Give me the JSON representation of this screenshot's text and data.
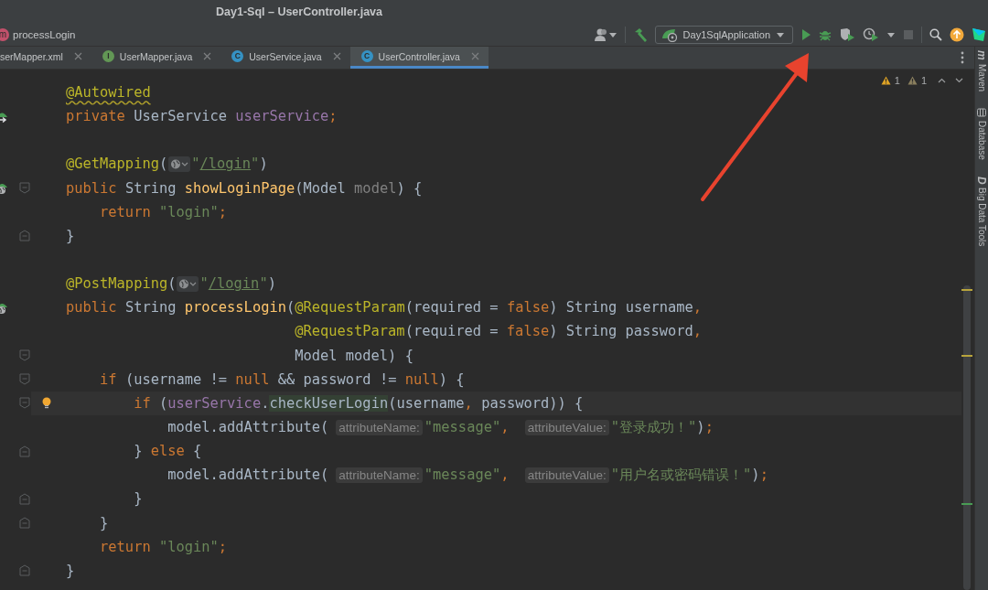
{
  "window": {
    "title": "Day1-Sql – UserController.java"
  },
  "breadcrumb": {
    "icon_text": "m",
    "label": "processLogin"
  },
  "toolbar": {
    "run_configuration": "Day1SqlApplication"
  },
  "tabs": [
    {
      "label": "serMapper.xml",
      "selected": false
    },
    {
      "label": "UserMapper.java",
      "kind": "interface",
      "icon_text": "I",
      "selected": false
    },
    {
      "label": "UserService.java",
      "kind": "class",
      "icon_text": "C",
      "selected": false
    },
    {
      "label": "UserController.java",
      "kind": "class",
      "icon_text": "C",
      "selected": true
    }
  ],
  "inspections": [
    {
      "kind": "warning",
      "count": "1"
    },
    {
      "kind": "weak",
      "count": "1"
    }
  ],
  "tool_windows": [
    {
      "label": "Maven",
      "kind": "letter",
      "icon_text": "m"
    },
    {
      "label": "Database",
      "kind": "database"
    },
    {
      "label": "Big Data Tools",
      "kind": "letter",
      "icon_text": "D"
    }
  ],
  "lines": [
    {
      "segments": [
        {
          "kind": "code",
          "tokens": [
            {
              "kind": "annotation-warn",
              "text": "@Autowired"
            }
          ]
        }
      ]
    },
    {
      "gutter_icon": {
        "kind": "bean"
      },
      "segments": [
        {
          "kind": "code",
          "tokens": [
            {
              "kind": "keyword",
              "text": "private "
            },
            {
              "kind": "plain",
              "text": "UserService "
            },
            {
              "kind": "field",
              "text": "userService"
            },
            {
              "kind": "keyword",
              "text": ";"
            }
          ]
        }
      ]
    },
    {
      "blank_line_before": true,
      "segments": [
        {
          "kind": "code",
          "tokens": [
            {
              "kind": "annotation",
              "text": "@GetMapping"
            },
            {
              "kind": "plain",
              "text": "("
            }
          ]
        },
        {
          "kind": "globe"
        },
        {
          "kind": "code",
          "tokens": [
            {
              "kind": "string",
              "text": "\""
            },
            {
              "kind": "link",
              "text": "/login"
            },
            {
              "kind": "string",
              "text": "\""
            },
            {
              "kind": "plain",
              "text": ")"
            }
          ]
        }
      ]
    },
    {
      "gutter_icon": {
        "kind": "endpoint"
      },
      "fold_marker": {
        "kind": "start"
      },
      "segments": [
        {
          "kind": "code",
          "tokens": [
            {
              "kind": "keyword",
              "text": "public "
            },
            {
              "kind": "plain",
              "text": "String "
            },
            {
              "kind": "method",
              "text": "showLoginPage"
            },
            {
              "kind": "plain",
              "text": "(Model "
            },
            {
              "kind": "unused",
              "text": "model"
            },
            {
              "kind": "plain",
              "text": ") {"
            }
          ]
        }
      ]
    },
    {
      "segments": [
        {
          "kind": "code",
          "tokens": [
            {
              "kind": "keyword",
              "text": "    return "
            },
            {
              "kind": "string",
              "text": "\"login\""
            },
            {
              "kind": "keyword",
              "text": ";"
            }
          ]
        }
      ]
    },
    {
      "fold_marker": {
        "kind": "end"
      },
      "segments": [
        {
          "kind": "code",
          "tokens": [
            {
              "kind": "plain",
              "text": "}"
            }
          ]
        }
      ]
    },
    {
      "blank_line_before": true,
      "segments": [
        {
          "kind": "code",
          "tokens": [
            {
              "kind": "annotation",
              "text": "@PostMapping"
            },
            {
              "kind": "plain",
              "text": "("
            }
          ]
        },
        {
          "kind": "globe"
        },
        {
          "kind": "code",
          "tokens": [
            {
              "kind": "string",
              "text": "\""
            },
            {
              "kind": "link",
              "text": "/login"
            },
            {
              "kind": "string",
              "text": "\""
            },
            {
              "kind": "plain",
              "text": ")"
            }
          ]
        }
      ]
    },
    {
      "gutter_icon": {
        "kind": "endpoint"
      },
      "segments": [
        {
          "kind": "code",
          "tokens": [
            {
              "kind": "keyword",
              "text": "public "
            },
            {
              "kind": "plain",
              "text": "String "
            },
            {
              "kind": "method",
              "text": "processLogin"
            },
            {
              "kind": "plain",
              "text": "("
            },
            {
              "kind": "annotation",
              "text": "@RequestParam"
            },
            {
              "kind": "plain",
              "text": "(required = "
            },
            {
              "kind": "keyword",
              "text": "false"
            },
            {
              "kind": "plain",
              "text": ") String username"
            },
            {
              "kind": "keyword",
              "text": ","
            }
          ]
        }
      ]
    },
    {
      "segments": [
        {
          "kind": "code",
          "tokens": [
            {
              "kind": "annotation",
              "text": "                           @RequestParam"
            },
            {
              "kind": "plain",
              "text": "(required = "
            },
            {
              "kind": "keyword",
              "text": "false"
            },
            {
              "kind": "plain",
              "text": ") String password"
            },
            {
              "kind": "keyword",
              "text": ","
            }
          ]
        }
      ]
    },
    {
      "fold_marker": {
        "kind": "start"
      },
      "segments": [
        {
          "kind": "code",
          "tokens": [
            {
              "kind": "plain",
              "text": "                           Model model) {"
            }
          ]
        }
      ]
    },
    {
      "fold_marker": {
        "kind": "start"
      },
      "segments": [
        {
          "kind": "code",
          "tokens": [
            {
              "kind": "keyword",
              "text": "    if"
            },
            {
              "kind": "plain",
              "text": " (username != "
            },
            {
              "kind": "keyword",
              "text": "null"
            },
            {
              "kind": "plain",
              "text": " && password != "
            },
            {
              "kind": "keyword",
              "text": "null"
            },
            {
              "kind": "plain",
              "text": ") {"
            }
          ]
        }
      ]
    },
    {
      "current": true,
      "gutter_icon": {
        "kind": "bulb"
      },
      "fold_marker": {
        "kind": "start"
      },
      "segments": [
        {
          "kind": "code",
          "tokens": [
            {
              "kind": "keyword",
              "text": "        if"
            },
            {
              "kind": "plain",
              "text": " ("
            },
            {
              "kind": "field",
              "text": "userService"
            },
            {
              "kind": "plain",
              "text": "."
            },
            {
              "kind": "match",
              "text": "checkUserLogin"
            },
            {
              "kind": "plain",
              "text": "(username"
            },
            {
              "kind": "keyword",
              "text": ", "
            },
            {
              "kind": "plain",
              "text": "password)) {"
            }
          ]
        }
      ]
    },
    {
      "segments": [
        {
          "kind": "code",
          "tokens": [
            {
              "kind": "plain",
              "text": "            model.addAttribute("
            }
          ]
        },
        {
          "kind": "hint",
          "text": "attributeName:"
        },
        {
          "kind": "code",
          "tokens": [
            {
              "kind": "string",
              "text": "\"message\""
            },
            {
              "kind": "keyword",
              "text": ", "
            }
          ]
        },
        {
          "kind": "hint",
          "text": "attributeValue:"
        },
        {
          "kind": "code",
          "tokens": [
            {
              "kind": "string",
              "text": "\"登录成功！\""
            },
            {
              "kind": "plain",
              "text": ")"
            },
            {
              "kind": "keyword",
              "text": ";"
            }
          ]
        }
      ]
    },
    {
      "fold_marker": {
        "kind": "end"
      },
      "segments": [
        {
          "kind": "code",
          "tokens": [
            {
              "kind": "plain",
              "text": "        } "
            },
            {
              "kind": "keyword",
              "text": "else"
            },
            {
              "kind": "plain",
              "text": " {"
            }
          ]
        }
      ]
    },
    {
      "segments": [
        {
          "kind": "code",
          "tokens": [
            {
              "kind": "plain",
              "text": "            model.addAttribute("
            }
          ]
        },
        {
          "kind": "hint",
          "text": "attributeName:"
        },
        {
          "kind": "code",
          "tokens": [
            {
              "kind": "string",
              "text": "\"message\""
            },
            {
              "kind": "keyword",
              "text": ", "
            }
          ]
        },
        {
          "kind": "hint",
          "text": "attributeValue:"
        },
        {
          "kind": "code",
          "tokens": [
            {
              "kind": "string",
              "text": "\"用户名或密码错误！\""
            },
            {
              "kind": "plain",
              "text": ")"
            },
            {
              "kind": "keyword",
              "text": ";"
            }
          ]
        }
      ]
    },
    {
      "fold_marker": {
        "kind": "end"
      },
      "segments": [
        {
          "kind": "code",
          "tokens": [
            {
              "kind": "plain",
              "text": "        }"
            }
          ]
        }
      ]
    },
    {
      "fold_marker": {
        "kind": "end"
      },
      "segments": [
        {
          "kind": "code",
          "tokens": [
            {
              "kind": "plain",
              "text": "    }"
            }
          ]
        }
      ]
    },
    {
      "segments": [
        {
          "kind": "code",
          "tokens": [
            {
              "kind": "keyword",
              "text": "    return "
            },
            {
              "kind": "string",
              "text": "\"login\""
            },
            {
              "kind": "keyword",
              "text": ";"
            }
          ]
        }
      ]
    },
    {
      "fold_marker": {
        "kind": "end"
      },
      "segments": [
        {
          "kind": "code",
          "tokens": [
            {
              "kind": "plain",
              "text": "}"
            }
          ]
        }
      ]
    }
  ]
}
